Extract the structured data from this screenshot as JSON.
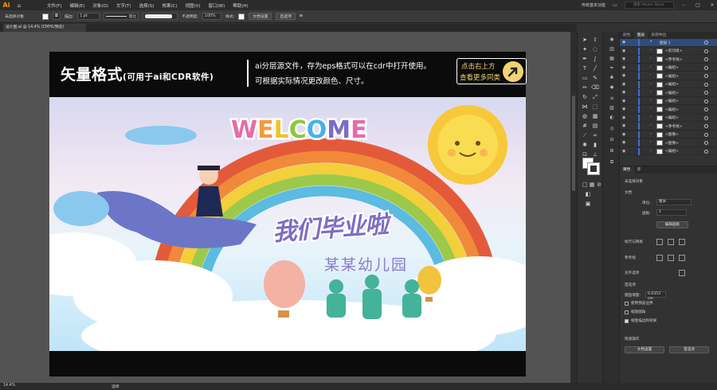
{
  "app": {
    "logo": "Ai"
  },
  "menu": [
    "文件(F)",
    "编辑(E)",
    "对象(O)",
    "文字(T)",
    "选择(S)",
    "效果(C)",
    "视图(V)",
    "窗口(W)",
    "帮助(H)"
  ],
  "workspace": "传统基本功能",
  "search_placeholder": "搜索 Adobe Stock",
  "control_bar": {
    "selection": "未选择对象",
    "stroke_label": "描边:",
    "stroke_value": "1 pt",
    "profile": "等比",
    "opacity_label": "不透明度:",
    "opacity_value": "100%",
    "style_label": "样式:",
    "doc_setup": "文档设置",
    "preferences": "首选项"
  },
  "document_tab": "设计图.ai @ 14.4% (CMYK/预览)",
  "banner": {
    "title": "矢量格式",
    "title_small": "(可用于ai和CDR软件)",
    "line1": "ai分层源文件，存为eps格式可以在cdr中打开使用。",
    "line2": "可根据实际情况更改颜色、尺寸。",
    "corner_line1": "点击右上方",
    "corner_line2": "查看更多同类"
  },
  "artwork": {
    "welcome_letters": [
      "W",
      "E",
      "L",
      "C",
      "O",
      "M",
      "E"
    ],
    "welcome_colors": [
      "#e86aa8",
      "#f39a3c",
      "#f2c12e",
      "#8cc63f",
      "#45b3e6",
      "#7d6cc7",
      "#e86aa8"
    ],
    "headline": "我们毕业啦",
    "kindergarten": "某某幼儿园"
  },
  "layers_panel": {
    "tabs": [
      "颜色",
      "图层",
      "资源导出"
    ],
    "rows": [
      {
        "name": "图层 1",
        "top": true
      },
      {
        "name": "<剪切组>"
      },
      {
        "name": "<参考线>"
      },
      {
        "name": "<编组>"
      },
      {
        "name": "<编组>"
      },
      {
        "name": "<编组>"
      },
      {
        "name": "<编组>"
      },
      {
        "name": "<编组>"
      },
      {
        "name": "<编组>"
      },
      {
        "name": "<编组>"
      },
      {
        "name": "<参考线>"
      },
      {
        "name": "<图像>"
      },
      {
        "name": "<图像>"
      },
      {
        "name": "<编组>"
      }
    ]
  },
  "properties_panel": {
    "tabs": [
      "属性",
      "库"
    ],
    "no_selection": "未选择对象",
    "document": "文档",
    "unit_label": "单位:",
    "unit_value": "厘米",
    "artboard_label": "画板:",
    "artboard_value": "1",
    "edit_artboard": "编辑画板",
    "ruler_grid": "标尺与网格",
    "guides": "参考线",
    "align": "对齐选项",
    "prefs": "首选项",
    "nudge_label": "键盘增量:",
    "nudge_value": "0.0353",
    "nudge_unit": "cm",
    "check1": "使用预览边界",
    "check2": "缩放圆角",
    "check3": "缩放描边和效果",
    "quick_actions": "快速操作",
    "doc_setup_btn": "文档设置",
    "prefs_btn": "首选项"
  },
  "status": {
    "zoom": "14.4%",
    "tool": "选择"
  }
}
